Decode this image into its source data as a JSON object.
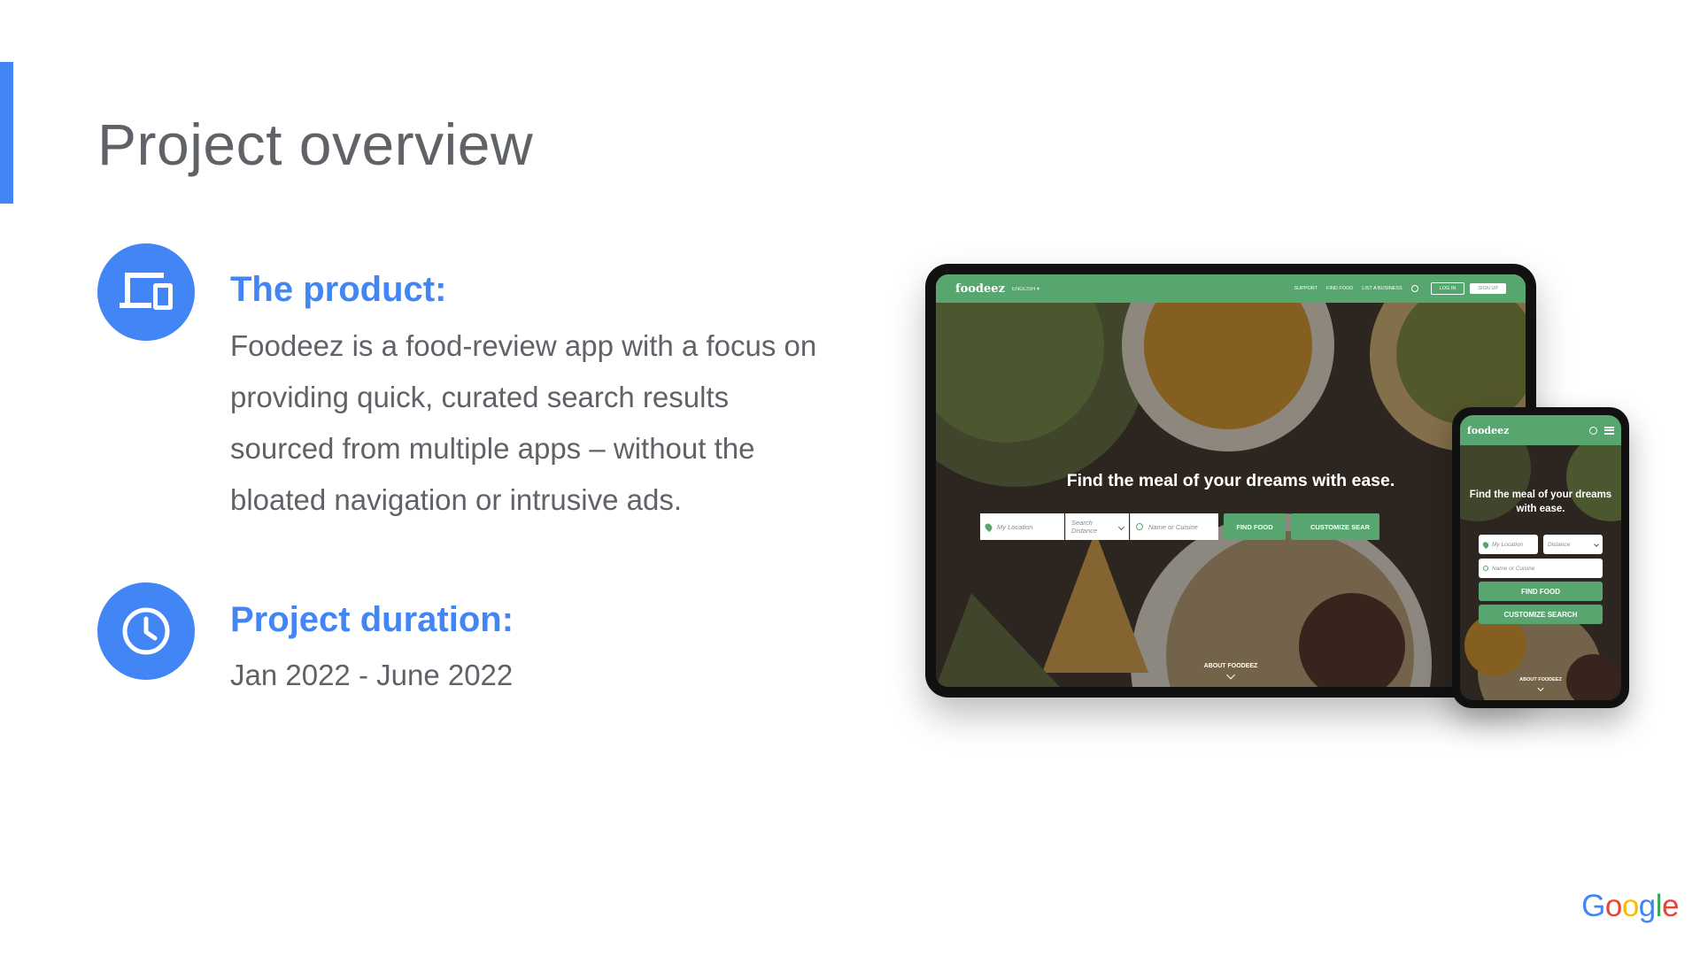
{
  "slide": {
    "title": "Project overview",
    "accent_color": "#4285f4"
  },
  "product": {
    "icon": "devices-icon",
    "heading": "The product:",
    "body_lines": [
      "Foodeez is a food-review app with a focus on",
      "providing quick, curated search results",
      "sourced from multiple apps – without the",
      "bloated navigation or intrusive ads."
    ]
  },
  "duration": {
    "icon": "clock-icon",
    "heading": "Project duration:",
    "value": "Jan 2022 - June 2022"
  },
  "tablet_mockup": {
    "logo": "foodeez",
    "language": "ENGLISH ▾",
    "nav_links": [
      "SUPPORT",
      "FIND FOOD",
      "LIST A BUSINESS"
    ],
    "login": "LOG IN",
    "signup": "SIGN UP",
    "hero": "Find the meal of your dreams with ease.",
    "location_placeholder": "My Location",
    "distance_placeholder": "Search Distance",
    "cuisine_placeholder": "Name or Cuisine",
    "find_food": "FIND FOOD",
    "customize_search": "CUSTOMIZE SEAR",
    "about": "ABOUT FOODEEZ",
    "brand_color": "#57a56f"
  },
  "phone_mockup": {
    "logo": "foodeez",
    "hero": "Find the meal of your dreams with ease.",
    "location_placeholder": "My Location",
    "distance_placeholder": "Distance",
    "cuisine_placeholder": "Name or Cuisine",
    "find_food": "FIND FOOD",
    "customize_search": "CUSTOMIZE SEARCH",
    "about": "ABOUT FOODEEZ"
  },
  "footer": {
    "brand_letters": [
      "G",
      "o",
      "o",
      "g",
      "l",
      "e"
    ],
    "brand_colors": [
      "#4285f4",
      "#ea4335",
      "#fbbc05",
      "#4285f4",
      "#34a853",
      "#ea4335"
    ]
  }
}
